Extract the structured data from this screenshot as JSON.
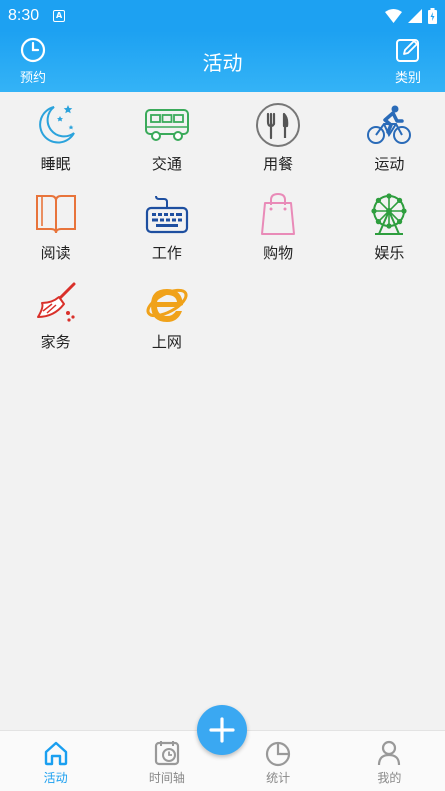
{
  "status": {
    "time": "8:30",
    "notification": "A"
  },
  "header": {
    "title": "活动",
    "left_label": "预约",
    "right_label": "类别"
  },
  "categories": [
    {
      "label": "睡眠",
      "icon": "moon-stars-icon"
    },
    {
      "label": "交通",
      "icon": "bus-icon"
    },
    {
      "label": "用餐",
      "icon": "fork-knife-icon"
    },
    {
      "label": "运动",
      "icon": "bicycle-icon"
    },
    {
      "label": "阅读",
      "icon": "book-icon"
    },
    {
      "label": "工作",
      "icon": "keyboard-icon"
    },
    {
      "label": "购物",
      "icon": "shopping-bag-icon"
    },
    {
      "label": "娱乐",
      "icon": "ferris-wheel-icon"
    },
    {
      "label": "家务",
      "icon": "broom-icon"
    },
    {
      "label": "上网",
      "icon": "internet-explorer-icon"
    }
  ],
  "tabs": [
    {
      "label": "活动",
      "icon": "home-icon",
      "active": true
    },
    {
      "label": "时间轴",
      "icon": "timeline-icon",
      "active": false
    },
    {
      "label": "统计",
      "icon": "pie-chart-icon",
      "active": false
    },
    {
      "label": "我的",
      "icon": "user-icon",
      "active": false
    }
  ],
  "colors": {
    "primary": "#1da1f2",
    "tab_active": "#1a9ff0",
    "fab": "#3aa8f2"
  }
}
